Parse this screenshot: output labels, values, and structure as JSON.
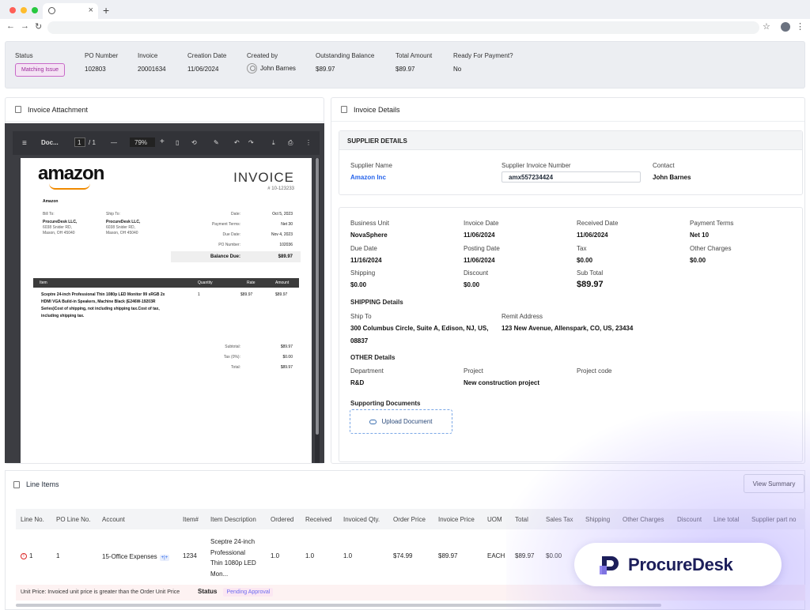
{
  "summary": {
    "status_label": "Status",
    "status_value": "Matching Issue",
    "po_label": "PO Number",
    "po_value": "102803",
    "invoice_label": "Invoice",
    "invoice_value": "20001634",
    "creation_label": "Creation Date",
    "creation_value": "11/06/2024",
    "created_by_label": "Created by",
    "created_by_value": "John Barnes",
    "outstanding_label": "Outstanding Balance",
    "outstanding_value": "$89.97",
    "total_label": "Total Amount",
    "total_value": "$89.97",
    "ready_label": "Ready For Payment?",
    "ready_value": "No"
  },
  "attachment": {
    "title": "Invoice Attachment",
    "toolbar": {
      "doc_name": "Doc...",
      "page_current": "1",
      "page_total": "/ 1",
      "zoom": "79%",
      "minus": "—",
      "plus": "+"
    },
    "pdf": {
      "logo": "amazon",
      "invoice_title": "INVOICE",
      "invoice_number": "# 10-123233",
      "seller": "Amazon",
      "bill_to_label": "Bill To:",
      "bill_to_name": "ProcureDesk LLC,",
      "bill_to_addr1": "6038 Snider RD,",
      "bill_to_addr2": "Mason, OH 45040",
      "ship_to_label": "Ship To:",
      "ship_to_name": "ProcureDesk LLC,",
      "ship_to_addr1": "6038 Snider RD,",
      "ship_to_addr2": "Mason, OH 45040",
      "date_label": "Date:",
      "date_value": "Oct 5, 2023",
      "terms_label": "Payment Terms:",
      "terms_value": "Net 30",
      "due_label": "Due Date:",
      "due_value": "Nov 4, 2023",
      "po_label": "PO Number:",
      "po_value": "102036",
      "balance_label": "Balance Due:",
      "balance_value": "$89.97",
      "col_item": "Item",
      "col_qty": "Quantity",
      "col_rate": "Rate",
      "col_amount": "Amount",
      "item_line1": "Sceptre 24-inch Professional Thin 1080p LED Monitor 99 sRGB 2x",
      "item_line2": "HDMI VGA Build-in Speakers, Machine Black (E246W-19203R",
      "item_line3": "Series)Cost of shipping, not including shipping tax.Cost of tax,",
      "item_line4": "including shipping tax.",
      "item_qty": "1",
      "item_rate": "$89.97",
      "item_amount": "$89.97",
      "subtotal_label": "Subtotal:",
      "subtotal_value": "$89.97",
      "tax_label": "Tax (0%):",
      "tax_value": "$0.00",
      "total_label": "Total:",
      "total_value": "$89.97"
    }
  },
  "details": {
    "title": "Invoice Details",
    "supplier": {
      "heading": "SUPPLIER DETAILS",
      "name_label": "Supplier Name",
      "name_value": "Amazon Inc",
      "inv_num_label": "Supplier Invoice Number",
      "inv_num_value": "amx557234424",
      "contact_label": "Contact",
      "contact_value": "John Barnes"
    },
    "business_unit_label": "Business Unit",
    "business_unit_value": "NovaSphere",
    "invoice_date_label": "Invoice Date",
    "invoice_date_value": "11/06/2024",
    "received_date_label": "Received Date",
    "received_date_value": "11/06/2024",
    "payment_terms_label": "Payment Terms",
    "payment_terms_value": "Net 10",
    "due_date_label": "Due Date",
    "due_date_value": "11/16/2024",
    "posting_date_label": "Posting Date",
    "posting_date_value": "11/06/2024",
    "tax_label": "Tax",
    "tax_value": "$0.00",
    "other_charges_label": "Other Charges",
    "other_charges_value": "$0.00",
    "shipping_label": "Shipping",
    "shipping_value": "$0.00",
    "discount_label": "Discount",
    "discount_value": "$0.00",
    "subtotal_label": "Sub Total",
    "subtotal_value": "$89.97",
    "shipping_heading": "SHIPPING Details",
    "ship_to_label": "Ship To",
    "ship_to_line1": "300 Columbus Circle, Suite A, Edison, NJ, US,",
    "ship_to_line2": "08837",
    "remit_label": "Remit Address",
    "remit_value": "123 New Avenue, Allenspark, CO, US, 23434",
    "other_heading": "OTHER Details",
    "department_label": "Department",
    "department_value": "R&D",
    "project_label": "Project",
    "project_value": "New construction project",
    "project_code_label": "Project code",
    "supporting_label": "Supporting Documents",
    "upload_label": "Upload Document"
  },
  "line_items": {
    "title": "Line Items",
    "view_summary": "View Summary",
    "columns": [
      "Line No.",
      "PO Line No.",
      "Account",
      "Item#",
      "Item Description",
      "Ordered",
      "Received",
      "Invoiced Qty.",
      "Order Price",
      "Invoice Price",
      "UOM",
      "Total",
      "Sales Tax",
      "Shipping",
      "Other Charges",
      "Discount",
      "Line total",
      "Supplier part no"
    ],
    "row": {
      "line_no": "1",
      "po_line_no": "1",
      "account": "15-Office Expenses",
      "account_tag": "+|+",
      "item_no": "1234",
      "desc_line1": "Sceptre 24-inch",
      "desc_line2": "Professional",
      "desc_line3": "Thin 1080p LED",
      "desc_line4": "Mon...",
      "ordered": "1.0",
      "received": "1.0",
      "invoiced": "1.0",
      "order_price": "$74.99",
      "invoice_price": "$89.97",
      "uom": "EACH",
      "total": "$89.97",
      "sales_tax": "$0.00"
    },
    "error_text": "Unit Price: Invoiced unit price is greater than the Order Unit Price",
    "status_label": "Status",
    "status_value": "Pending Approval"
  },
  "brand": {
    "name": "ProcureDesk"
  },
  "colors": {
    "accent": "#2563eb",
    "issue": "#9c2b9c",
    "brand_dark": "#1c1e5a",
    "brand_light": "#8a7cf0"
  }
}
